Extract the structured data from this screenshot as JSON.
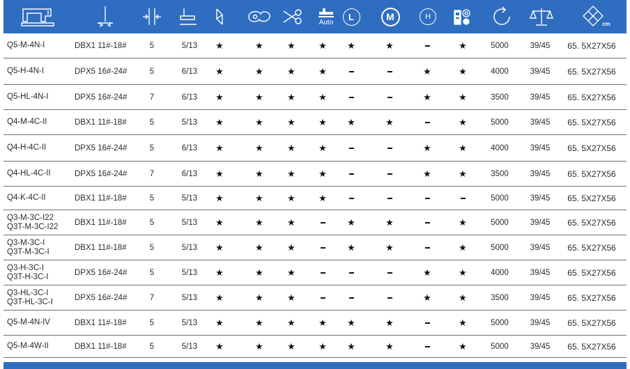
{
  "header": {
    "icons": [
      "sewing-machine-icon",
      "needle-icon",
      "stitch-length-icon",
      "presser-foot-icon",
      "zigzag-icon",
      "thread-winder-icon",
      "scissors-icon",
      "auto-foot-lift-icon",
      "light-duty-icon",
      "medium-duty-icon",
      "heavy-duty-icon",
      "control-panel-icon",
      "speed-icon",
      "weight-scale-icon",
      "package-size-icon"
    ],
    "auto_label": "Auto",
    "l_label": "L",
    "m_label": "M",
    "h_label": "H",
    "cm_label": "cm"
  },
  "colors": {
    "header_bg": "#2f6dc0",
    "rule": "#6e6e6e"
  },
  "rows": [
    {
      "model": [
        "Q5-M-4N-I"
      ],
      "needle": "DBX1  11#-18#",
      "c3": "5",
      "c4": "5/13",
      "marks": [
        "star",
        "star",
        "star",
        "star",
        "star",
        "star",
        "dash",
        "star"
      ],
      "speed": "5000",
      "weight": "39/45",
      "size": "65. 5X27X56"
    },
    {
      "model": [
        "Q5-H-4N-I"
      ],
      "needle": "DPX5  16#-24#",
      "c3": "5",
      "c4": "6/13",
      "marks": [
        "star",
        "star",
        "star",
        "star",
        "dash",
        "dash",
        "star",
        "star"
      ],
      "speed": "4000",
      "weight": "39/45",
      "size": "65. 5X27X56"
    },
    {
      "model": [
        "Q5-HL-4N-I"
      ],
      "needle": "DPX5  16#-24#",
      "c3": "7",
      "c4": "6/13",
      "marks": [
        "star",
        "star",
        "star",
        "star",
        "dash",
        "dash",
        "star",
        "star"
      ],
      "speed": "3500",
      "weight": "39/45",
      "size": "65. 5X27X56"
    },
    {
      "model": [
        "Q4-M-4C-II"
      ],
      "needle": "DBX1  11#-18#",
      "c3": "5",
      "c4": "5/13",
      "marks": [
        "star",
        "star",
        "star",
        "star",
        "star",
        "star",
        "dash",
        "star"
      ],
      "speed": "5000",
      "weight": "39/45",
      "size": "65. 5X27X56"
    },
    {
      "model": [
        "Q4-H-4C-II"
      ],
      "needle": "DPX5  16#-24#",
      "c3": "5",
      "c4": "6/13",
      "marks": [
        "star",
        "star",
        "star",
        "star",
        "dash",
        "dash",
        "star",
        "star"
      ],
      "speed": "4000",
      "weight": "39/45",
      "size": "65. 5X27X56"
    },
    {
      "model": [
        "Q4-HL-4C-II"
      ],
      "needle": "DPX5  16#-24#",
      "c3": "7",
      "c4": "6/13",
      "marks": [
        "star",
        "star",
        "star",
        "star",
        "dash",
        "dash",
        "star",
        "star"
      ],
      "speed": "3500",
      "weight": "39/45",
      "size": "65. 5X27X56"
    },
    {
      "model": [
        "Q4-K-4C-II"
      ],
      "needle": "DBX1 11#-18#",
      "c3": "5",
      "c4": "5/13",
      "marks": [
        "star",
        "star",
        "star",
        "star",
        "dash",
        "dash",
        "dash",
        "dash"
      ],
      "speed": "5000",
      "weight": "39/45",
      "size": "65. 5X27X56"
    },
    {
      "model": [
        "Q3-M-3C-I22",
        "Q3T-M-3C-I22"
      ],
      "needle": "DBX1  11#-18#",
      "c3": "5",
      "c4": "5/13",
      "marks": [
        "star",
        "star",
        "star",
        "dash",
        "star",
        "star",
        "dash",
        "star"
      ],
      "speed": "5000",
      "weight": "39/45",
      "size": "65. 5X27X56"
    },
    {
      "model": [
        "Q3-M-3C-I",
        "Q3T-M-3C-I"
      ],
      "needle": "DBX1  11#-18#",
      "c3": "5",
      "c4": "5/13",
      "marks": [
        "star",
        "star",
        "star",
        "dash",
        "star",
        "star",
        "dash",
        "star"
      ],
      "speed": "5000",
      "weight": "39/45",
      "size": "65. 5X27X56"
    },
    {
      "model": [
        "Q3-H-3C-I",
        "Q3T-H-3C-I"
      ],
      "needle": "DPX5  16#-24#",
      "c3": "5",
      "c4": "5/13",
      "marks": [
        "star",
        "star",
        "star",
        "dash",
        "dash",
        "dash",
        "star",
        "star"
      ],
      "speed": "4000",
      "weight": "39/45",
      "size": "65. 5X27X56"
    },
    {
      "model": [
        "Q3-HL-3C-I",
        "Q3T-HL-3C-I"
      ],
      "needle": "DPX5  16#-24#",
      "c3": "7",
      "c4": "5/13",
      "marks": [
        "star",
        "star",
        "star",
        "dash",
        "dash",
        "dash",
        "star",
        "star"
      ],
      "speed": "3500",
      "weight": "39/45",
      "size": "65. 5X27X56"
    },
    {
      "model": [
        "Q5-M-4N-IV"
      ],
      "needle": "DBX1  11#-18#",
      "c3": "5",
      "c4": "5/13",
      "marks": [
        "star",
        "star",
        "star",
        "star",
        "star",
        "star",
        "dash",
        "star"
      ],
      "speed": "5000",
      "weight": "39/45",
      "size": "65. 5X27X56"
    },
    {
      "model": [
        "Q5-M-4W-II"
      ],
      "needle": "DBX1  11#-18#",
      "c3": "5",
      "c4": "5/13",
      "marks": [
        "star",
        "star",
        "star",
        "star",
        "star",
        "star",
        "dash",
        "star"
      ],
      "speed": "5000",
      "weight": "39/45",
      "size": "65. 5X27X56"
    }
  ]
}
